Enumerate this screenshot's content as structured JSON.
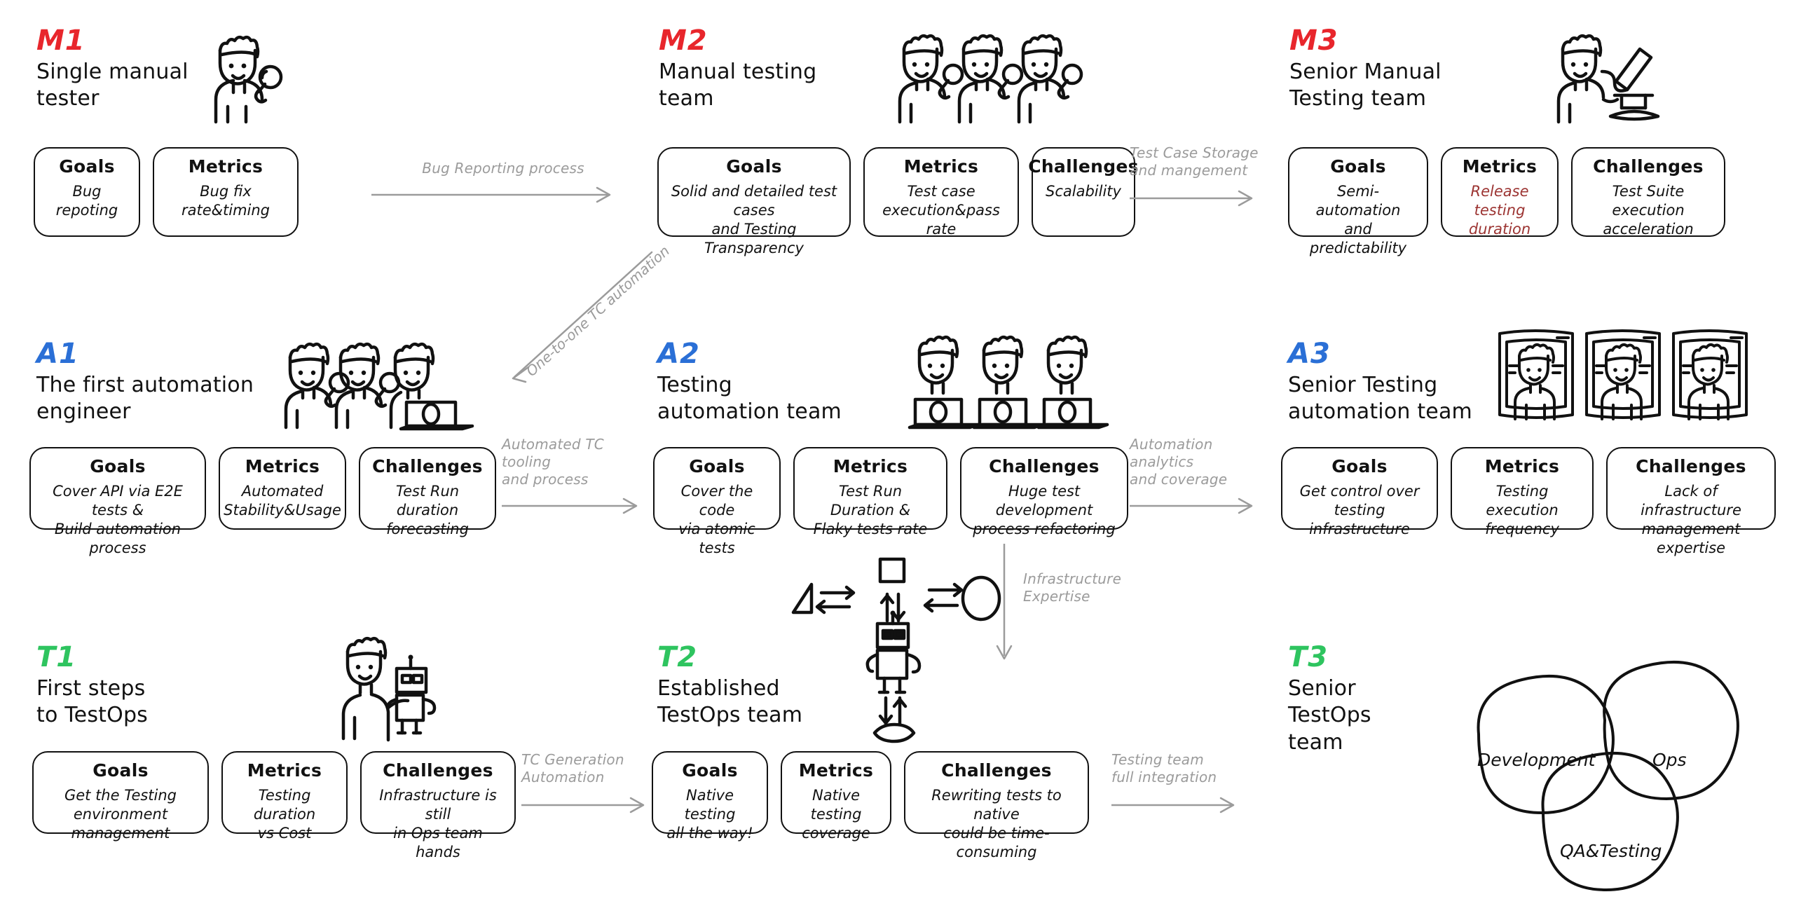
{
  "meta": {
    "accent_red": "#e8262c",
    "accent_blue": "#2a6fd6",
    "accent_green": "#2ec45f",
    "connector_gray": "#9b9b9b",
    "card_red_text": "#9c3432"
  },
  "stages": [
    {
      "code": "M1",
      "title": "Single manual\ntester",
      "color_key": "red",
      "icon": "single-manual-tester-icon",
      "cards": [
        {
          "header": "Goals",
          "body": "Bug repoting"
        },
        {
          "header": "Metrics",
          "body": "Bug fix rate&timing"
        }
      ]
    },
    {
      "code": "M2",
      "title": "Manual testing\nteam",
      "color_key": "red",
      "icon": "manual-testing-team-icon",
      "cards": [
        {
          "header": "Goals",
          "body": "Solid and detailed test cases\nand Testing Transparency"
        },
        {
          "header": "Metrics",
          "body": "Test case\nexecution&pass rate"
        },
        {
          "header": "Challenges",
          "body": "Scalability"
        }
      ]
    },
    {
      "code": "M3",
      "title": "Senior Manual\nTesting team",
      "color_key": "red",
      "icon": "microscope-tester-icon",
      "cards": [
        {
          "header": "Goals",
          "body": "Semi-automation\nand predictability"
        },
        {
          "header": "Metrics",
          "body": "Release testing\nduration",
          "emphasis": "red"
        },
        {
          "header": "Challenges",
          "body": "Test Suite execution\nacceleration"
        }
      ]
    },
    {
      "code": "A1",
      "title": "The first automation\nengineer",
      "color_key": "blue",
      "icon": "first-automation-engineer-icon",
      "cards": [
        {
          "header": "Goals",
          "body": "Cover API via E2E tests &\nBuild automation process"
        },
        {
          "header": "Metrics",
          "body": "Automated\nStability&Usage"
        },
        {
          "header": "Challenges",
          "body": "Test Run duration\nforecasting"
        }
      ]
    },
    {
      "code": "A2",
      "title": "Testing\nautomation team",
      "color_key": "blue",
      "icon": "automation-team-icon",
      "cards": [
        {
          "header": "Goals",
          "body": "Cover the code\nvia atomic tests"
        },
        {
          "header": "Metrics",
          "body": "Test Run Duration &\nFlaky tests rate"
        },
        {
          "header": "Challenges",
          "body": "Huge test development\nprocess refactoring"
        }
      ]
    },
    {
      "code": "A3",
      "title": "Senior Testing\nautomation team",
      "color_key": "blue",
      "icon": "senior-automation-team-icon",
      "cards": [
        {
          "header": "Goals",
          "body": "Get control over\ntesting infrastructure"
        },
        {
          "header": "Metrics",
          "body": "Testing execution\nfrequency"
        },
        {
          "header": "Challenges",
          "body": "Lack of infrastructure\nmanagement expertise"
        }
      ]
    },
    {
      "code": "T1",
      "title": "First steps\nto TestOps",
      "color_key": "green",
      "icon": "engineer-with-robot-icon",
      "cards": [
        {
          "header": "Goals",
          "body": "Get the Testing\nenvironment management"
        },
        {
          "header": "Metrics",
          "body": "Testing duration\nvs Cost"
        },
        {
          "header": "Challenges",
          "body": "Infrastructure is still\nin Ops team hands"
        }
      ]
    },
    {
      "code": "T2",
      "title": "Established\nTestOps team",
      "color_key": "green",
      "icon": "robot-integration-icon",
      "cards": [
        {
          "header": "Goals",
          "body": "Native testing\nall the way!"
        },
        {
          "header": "Metrics",
          "body": "Native testing\ncoverage"
        },
        {
          "header": "Challenges",
          "body": "Rewriting tests to native\ncould be time-consuming"
        }
      ]
    },
    {
      "code": "T3",
      "title": "Senior\nTestOps\nteam",
      "color_key": "green",
      "icon": "venn-diagram-icon",
      "cards": []
    }
  ],
  "connectors": [
    {
      "id": "m1-m2",
      "label": "Bug Reporting process",
      "direction": "right"
    },
    {
      "id": "m2-m3",
      "label": "Test Case Storage\nand mangement",
      "direction": "right"
    },
    {
      "id": "m2-a1",
      "label": "One-to-one TC automation",
      "direction": "down-left"
    },
    {
      "id": "a1-a2",
      "label": "Automated TC tooling\nand process",
      "direction": "right"
    },
    {
      "id": "a2-a3",
      "label": "Automation analytics\nand coverage",
      "direction": "right"
    },
    {
      "id": "a2-t2",
      "label": "Infrastructure\nExpertise",
      "direction": "down"
    },
    {
      "id": "t1-t2",
      "label": "TC Generation\nAutomation",
      "direction": "right"
    },
    {
      "id": "t2-t3",
      "label": "Testing team\nfull integration",
      "direction": "right"
    }
  ],
  "venn": {
    "circles": [
      {
        "label": "Development"
      },
      {
        "label": "Ops"
      },
      {
        "label": "QA&Testing"
      }
    ]
  }
}
